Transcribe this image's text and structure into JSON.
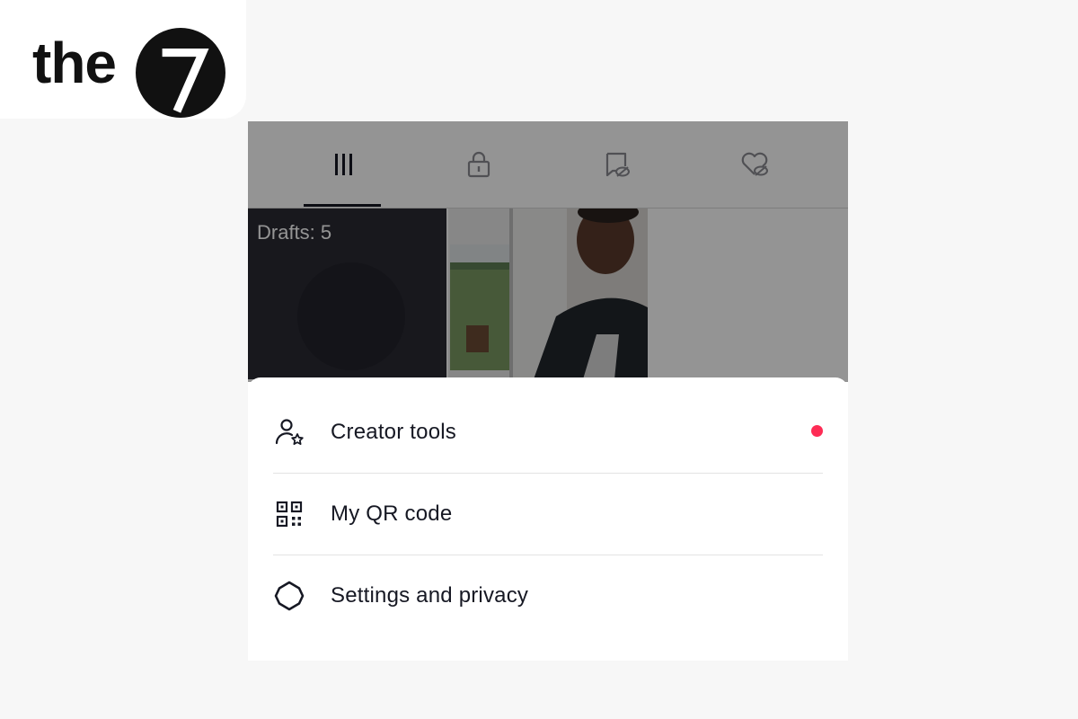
{
  "logo": {
    "text": "the",
    "mark_text": "7",
    "mark_icon": "seven-circle-logo"
  },
  "profile_tabs": [
    {
      "icon": "videos-grid-icon",
      "active": true
    },
    {
      "icon": "private-lock-icon",
      "active": false
    },
    {
      "icon": "reposts-hidden-icon",
      "active": false
    },
    {
      "icon": "liked-hidden-icon",
      "active": false
    }
  ],
  "grid": {
    "drafts_label": "Drafts: 5"
  },
  "menu": {
    "items": [
      {
        "label": "Creator tools",
        "icon": "creator-tools-icon",
        "badge": true
      },
      {
        "label": "My QR code",
        "icon": "qr-code-icon",
        "badge": false
      },
      {
        "label": "Settings and privacy",
        "icon": "settings-gear-icon",
        "badge": false
      }
    ]
  },
  "colors": {
    "text": "#161823",
    "badge": "#fe2c55",
    "overlay": "rgba(0,0,0,0.42)"
  }
}
